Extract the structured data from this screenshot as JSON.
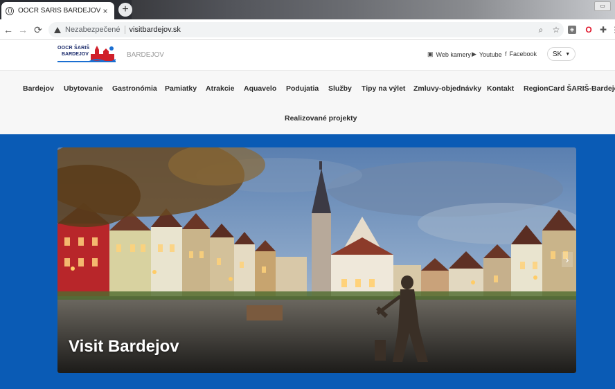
{
  "browser": {
    "tab_title": "OOCR ŠARIŠ BARDEJOV",
    "tab_close": "×",
    "new_tab": "+",
    "back": "←",
    "forward": "→",
    "reload": "⟳",
    "security_label": "Nezabezpečené",
    "url": "visitbardejov.sk",
    "zoom_icon": "search-icon",
    "bookmark_icon": "star-icon"
  },
  "site": {
    "logo_line1": "OOCR ŠARIŠ",
    "logo_line2": "BARDEJOV",
    "subtitle": "BARDEJOV",
    "social": {
      "webcams": "Web kamery",
      "youtube": "Youtube",
      "facebook": "Facebook"
    },
    "language": "SK"
  },
  "nav": {
    "items": [
      "Bardejov",
      "Ubytovanie",
      "Gastronómia",
      "Pamiatky",
      "Atrakcie",
      "Aquavelo",
      "Podujatia",
      "Služby",
      "Tipy na výlet",
      "Zmluvy-objednávky",
      "Kontakt",
      "RegionCard ŠARIŠ-Bardejov",
      "Realizované projekty"
    ]
  },
  "hero": {
    "title": "Visit Bardejov",
    "next_arrow": "›"
  },
  "colors": {
    "accent_blue": "#0a5bb5",
    "logo_navy": "#1b2b6b",
    "logo_red": "#d0202a"
  }
}
